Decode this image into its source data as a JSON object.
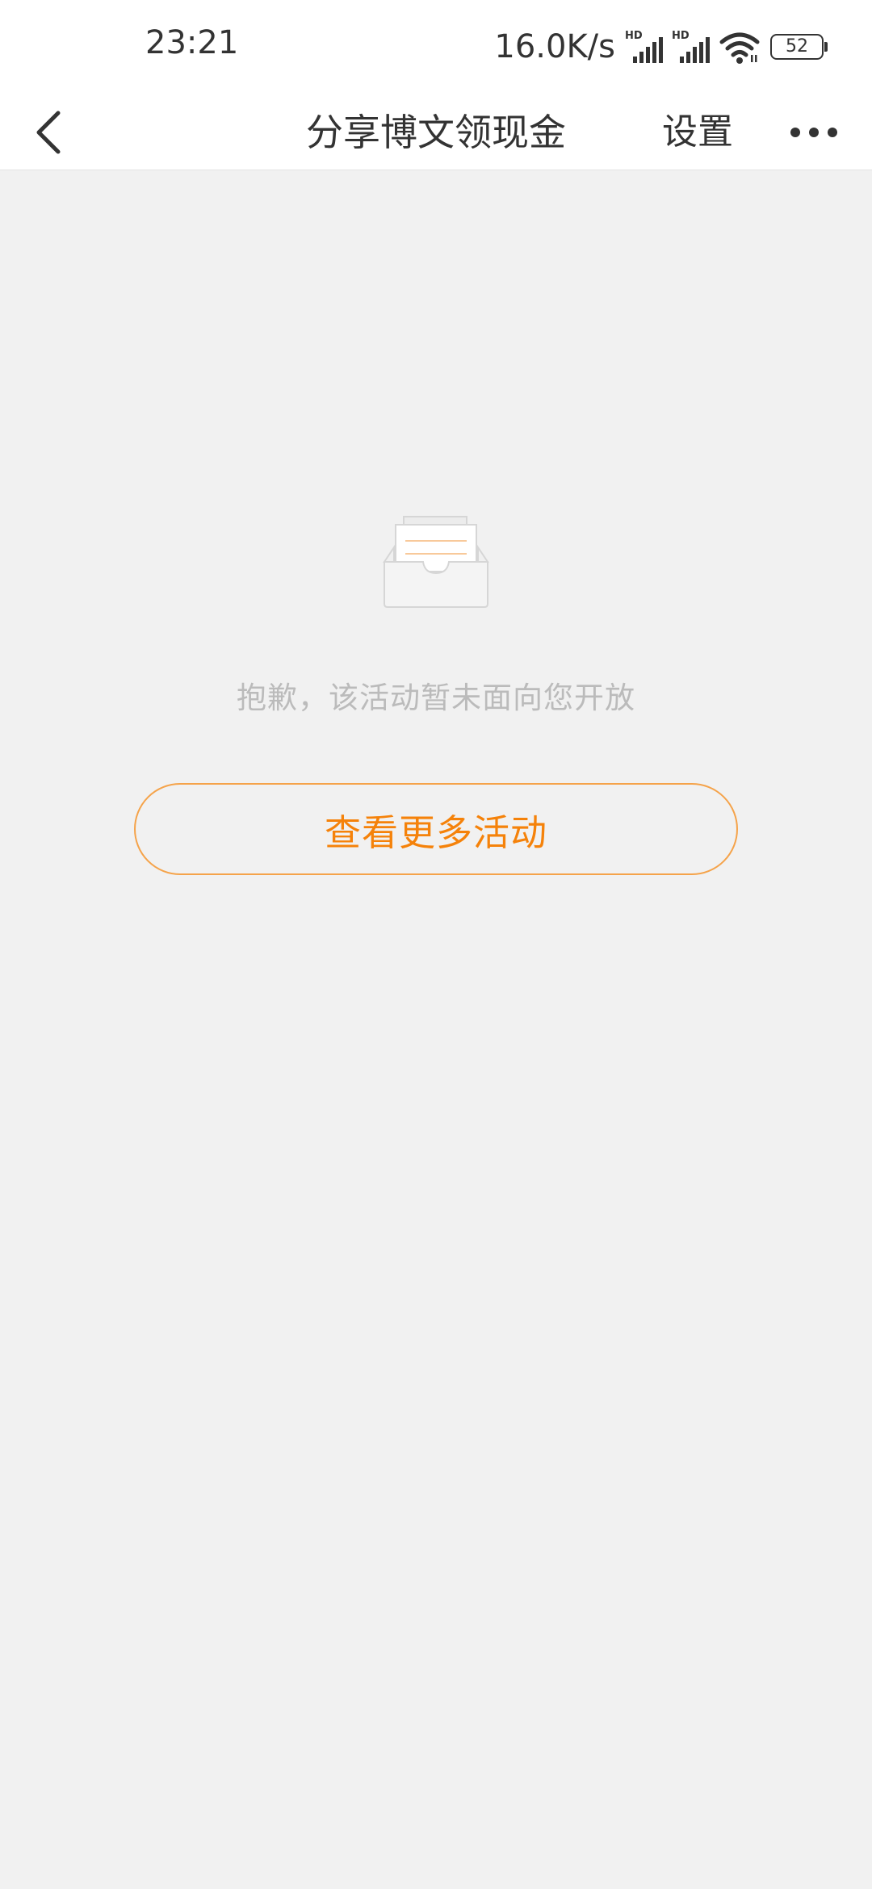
{
  "status_bar": {
    "time": "23:21",
    "net_speed": "16.0K/s",
    "signal_1_label": "HD",
    "signal_2_label": "HD",
    "battery": "52",
    "icons": [
      "hd-signal-icon",
      "hd-signal-icon",
      "wifi-icon",
      "battery-icon"
    ]
  },
  "nav": {
    "back_icon": "chevron-left-icon",
    "title": "分享博文领现金",
    "settings_label": "设置",
    "more_icon": "more-dots-icon"
  },
  "empty_state": {
    "icon": "empty-box-icon",
    "message": "抱歉，该活动暂未面向您开放",
    "button_label": "查看更多活动"
  },
  "colors": {
    "accent": "#f5820a",
    "button_border": "#f5a34a",
    "background": "#f1f1f1",
    "muted_text": "#bbbbbb"
  }
}
